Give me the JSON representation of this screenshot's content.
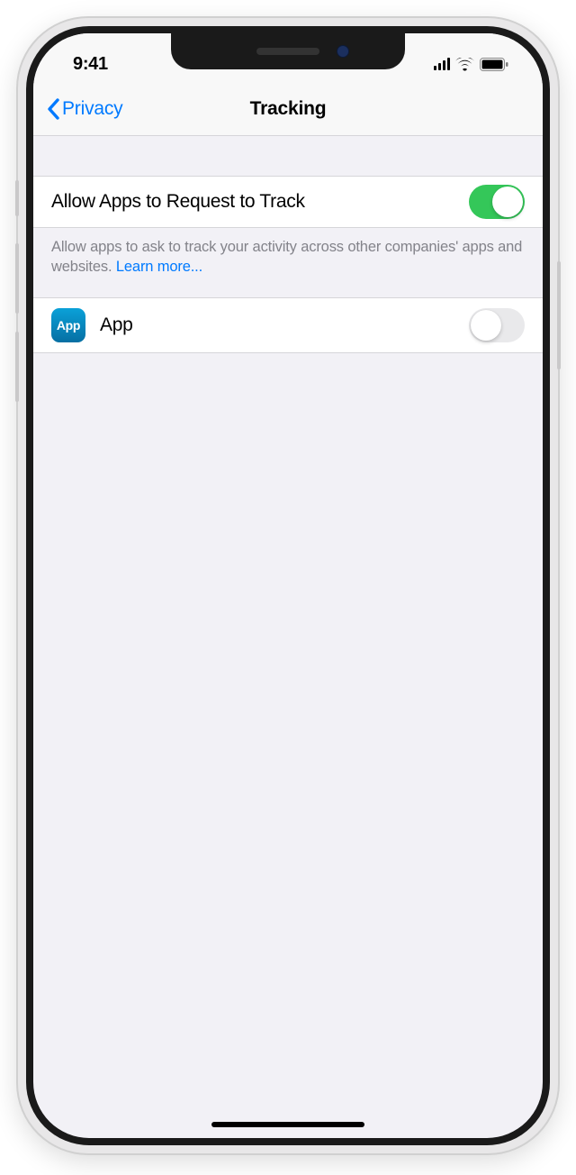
{
  "statusBar": {
    "time": "9:41"
  },
  "nav": {
    "backLabel": "Privacy",
    "title": "Tracking"
  },
  "allowRow": {
    "label": "Allow Apps to Request to Track",
    "enabled": true
  },
  "footer": {
    "text": "Allow apps to ask to track your activity across other companies' apps and websites. ",
    "learnMore": "Learn more..."
  },
  "appRow": {
    "iconText": "App",
    "name": "App",
    "enabled": false
  }
}
